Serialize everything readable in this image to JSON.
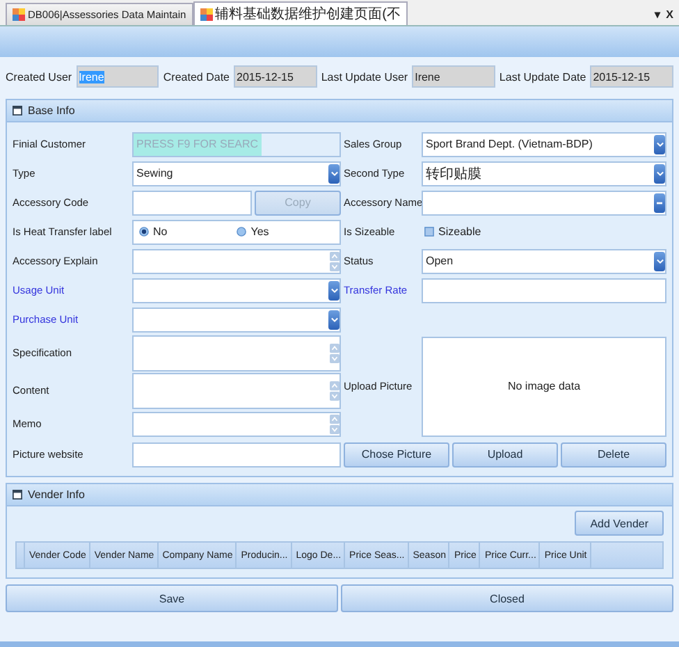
{
  "tabs": [
    {
      "label": "DB006|Assessories Data Maintain",
      "selected": false
    },
    {
      "label": "辅料基础数据维护创建页面(不",
      "selected": true
    }
  ],
  "tab_controls": [
    "▾",
    "X"
  ],
  "record": [
    {
      "label": "Created User",
      "value": "Irene",
      "text_selected": true
    },
    {
      "label": "Created Date",
      "value": "2015-12-15",
      "text_selected": false
    },
    {
      "label": "Last Update User",
      "value": "Irene",
      "text_selected": false
    },
    {
      "label": "Last Update Date",
      "value": "2015-12-15",
      "text_selected": false
    }
  ],
  "base_info": {
    "title": "Base Info",
    "left": [
      {
        "kind": "lookup",
        "label": "Finial Customer",
        "required": false,
        "placeholder": "PRESS F9 FOR SEARC"
      },
      {
        "kind": "dropdown",
        "label": "Type",
        "required": false,
        "value": "Sewing"
      },
      {
        "kind": "text_button",
        "label": "Accessory Code",
        "required": false,
        "button": "Copy",
        "disabled": true
      },
      {
        "kind": "radio",
        "label": "Is Heat Transfer label",
        "required": false,
        "options": [
          {
            "label": "No",
            "selected": true
          },
          {
            "label": "Yes",
            "selected": false
          }
        ]
      },
      {
        "kind": "memo",
        "label": "Accessory Explain",
        "required": false
      },
      {
        "kind": "dropdown",
        "label": "Usage Unit",
        "required": true
      },
      {
        "kind": "dropdown",
        "label": "Purchase Unit",
        "required": true
      },
      {
        "kind": "memo",
        "label": "Specification",
        "required": false
      },
      {
        "kind": "memo",
        "label": "Content",
        "required": false
      },
      {
        "kind": "memo",
        "label": "Memo",
        "required": false
      },
      {
        "kind": "text",
        "label": "Picture website",
        "required": false
      }
    ],
    "right": [
      {
        "kind": "dropdown",
        "label": "Sales Group",
        "required": false,
        "value": "Sport Brand Dept. (Vietnam-BDP)"
      },
      {
        "kind": "dropdown",
        "label": "Second Type",
        "required": false,
        "value": "转印贴膜"
      },
      {
        "kind": "ellipsis",
        "label": "Accessory Name",
        "required": false
      },
      {
        "kind": "checkbox",
        "label": "Is Sizeable",
        "required": false,
        "option": "Sizeable",
        "checked": false
      },
      {
        "kind": "dropdown",
        "label": "Status",
        "required": false,
        "value": "Open"
      },
      {
        "kind": "text",
        "label": "Transfer Rate",
        "required": true
      },
      {
        "kind": "picture",
        "label": "Upload Picture",
        "required": false,
        "value": "No image data"
      },
      {
        "kind": "buttons",
        "buttons": [
          "Chose Picture",
          "Upload",
          "Delete"
        ]
      }
    ]
  },
  "vender_info": {
    "title": "Vender Info",
    "button": "Add Vender",
    "columns": [
      "Vender Code",
      "Vender Name",
      "Company Name",
      "Producin...",
      "Logo De...",
      "Price Seas...",
      "Season",
      "Price",
      "Price Curr...",
      "Price Unit"
    ]
  },
  "footer_buttons": [
    "Save",
    "Closed"
  ]
}
